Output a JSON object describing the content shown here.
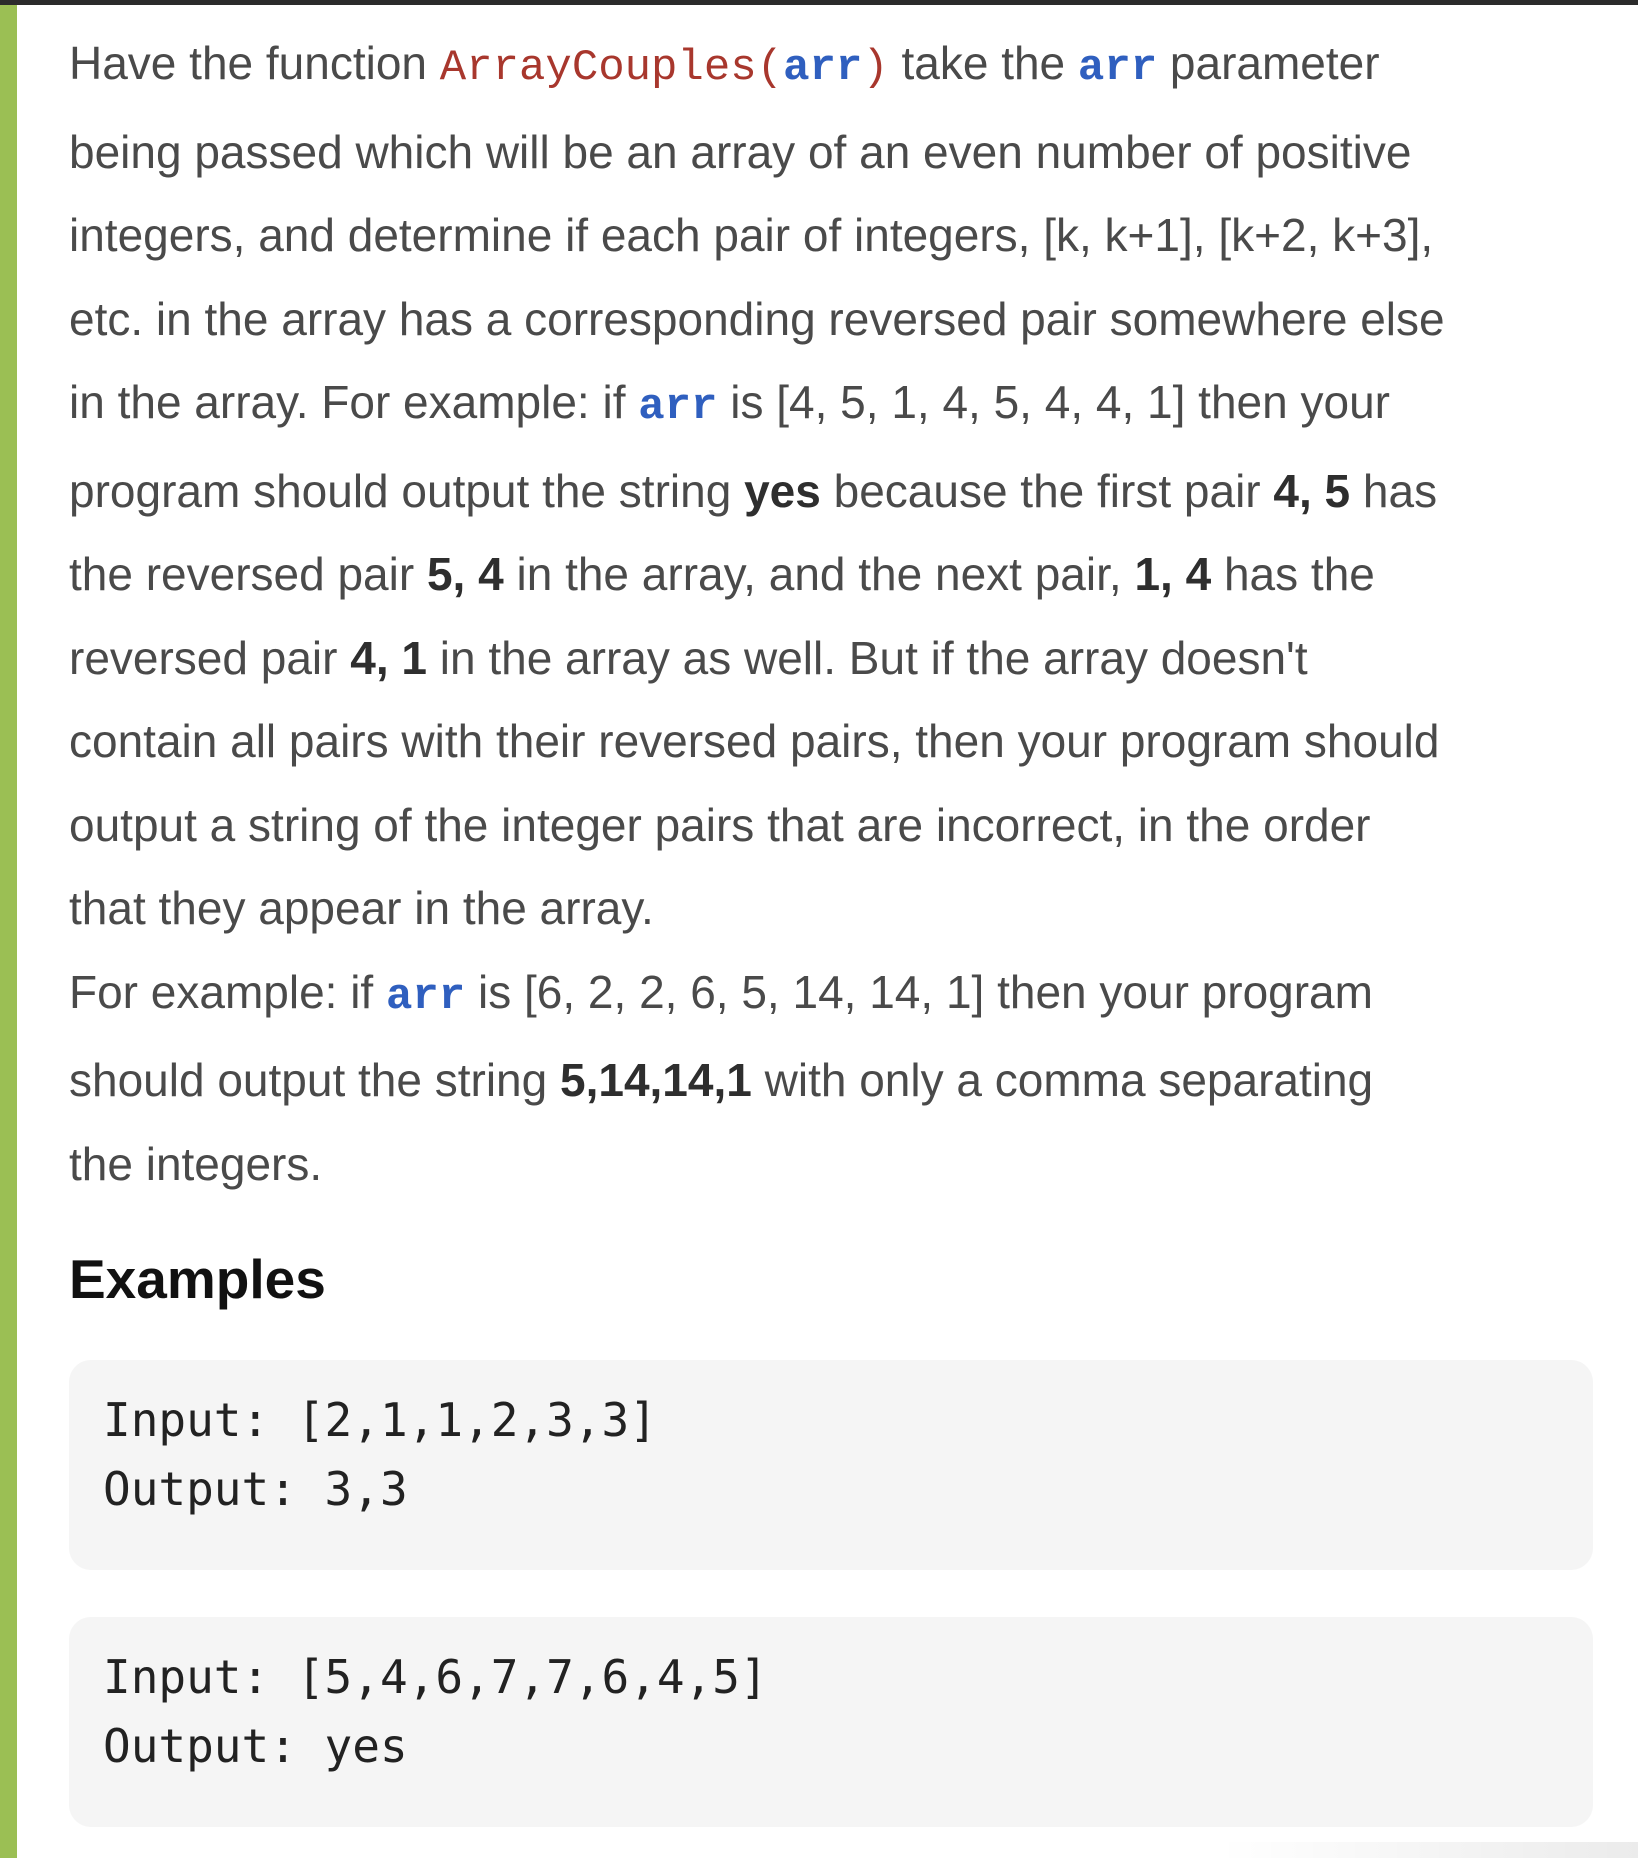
{
  "description": {
    "line1": {
      "a": "Have the function ",
      "fn": "ArrayCouples(",
      "arg": "arr",
      "close": ")",
      "b": " take the ",
      "var": "arr",
      "c": " parameter"
    },
    "line2": "being passed which will be an array of an even number of positive",
    "line3": "integers, and determine if each pair of integers, [k, k+1], [k+2, k+3],",
    "line4": "etc. in the array has a corresponding reversed pair somewhere else",
    "line5": {
      "a": "in the array. For example: if ",
      "var": "arr",
      "b": " is [4, 5, 1, 4, 5, 4, 4, 1] then your"
    },
    "line6": {
      "a": "program should output the string ",
      "b1": "yes",
      "c": " because the first pair ",
      "b2": "4, 5",
      "d": " has"
    },
    "line7": {
      "a": "the reversed pair ",
      "b1": "5, 4",
      "c": " in the array, and the next pair, ",
      "b2": "1, 4",
      "d": " has the"
    },
    "line8": {
      "a": "reversed pair ",
      "b1": "4, 1",
      "c": " in the array as well. But if the array doesn't"
    },
    "line9": "contain all pairs with their reversed pairs, then your program should",
    "line10": "output a string of the integer pairs that are incorrect, in the order",
    "line11": "that they appear in the array.",
    "line12": {
      "a": "For example: if ",
      "var": "arr",
      "b": " is [6, 2, 2, 6, 5, 14, 14, 1] then your program"
    },
    "line13": {
      "a": "should output the string ",
      "b1": "5,14,14,1",
      "c": " with only a comma separating"
    },
    "line14": "the integers."
  },
  "examples_heading": "Examples",
  "examples": [
    {
      "input": "Input: [2,1,1,2,3,3]",
      "output": "Output: 3,3"
    },
    {
      "input": "Input: [5,4,6,7,7,6,4,5]",
      "output": "Output: yes"
    }
  ],
  "colors": {
    "accent_bar": "#9bbf54",
    "function_name": "#a8372d",
    "code_variable": "#2f5fbf",
    "code_block_bg": "#f5f5f5"
  }
}
